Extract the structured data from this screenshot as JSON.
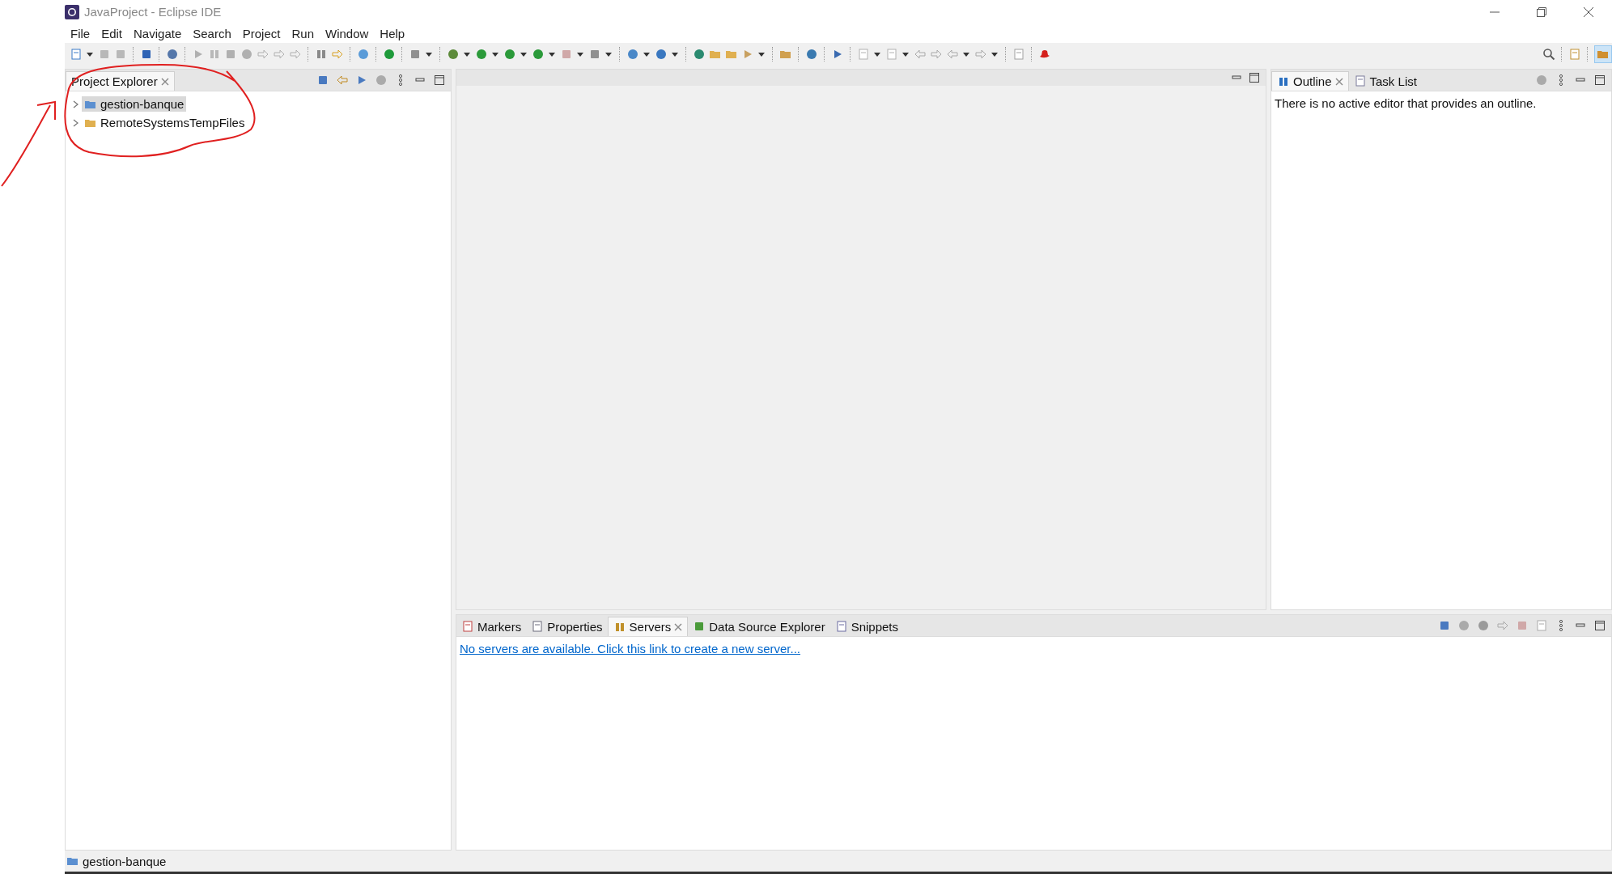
{
  "window": {
    "title": "JavaProject - Eclipse IDE"
  },
  "menu": [
    "File",
    "Edit",
    "Navigate",
    "Search",
    "Project",
    "Run",
    "Window",
    "Help"
  ],
  "project_explorer": {
    "tab": {
      "label": "Project Explorer",
      "selected": true
    },
    "tree": [
      {
        "label": "gestion-banque",
        "kind": "java-project",
        "selected": true,
        "expanded": false
      },
      {
        "label": "RemoteSystemsTempFiles",
        "kind": "folder",
        "selected": false,
        "expanded": false
      }
    ]
  },
  "outline_panel": {
    "tabs": [
      {
        "label": "Outline",
        "kind": "outline",
        "selected": true
      },
      {
        "label": "Task List",
        "kind": "tasks",
        "selected": false
      }
    ],
    "message": "There is no active editor that provides an outline."
  },
  "bottom_panel": {
    "tabs": [
      {
        "label": "Markers",
        "kind": "markers",
        "selected": false
      },
      {
        "label": "Properties",
        "kind": "properties",
        "selected": false
      },
      {
        "label": "Servers",
        "kind": "servers",
        "selected": true
      },
      {
        "label": "Data Source Explorer",
        "kind": "datasource",
        "selected": false
      },
      {
        "label": "Snippets",
        "kind": "snippets",
        "selected": false
      }
    ],
    "link": "No servers are available. Click this link to create a new server..."
  },
  "status_bar": {
    "text": "gestion-banque"
  }
}
